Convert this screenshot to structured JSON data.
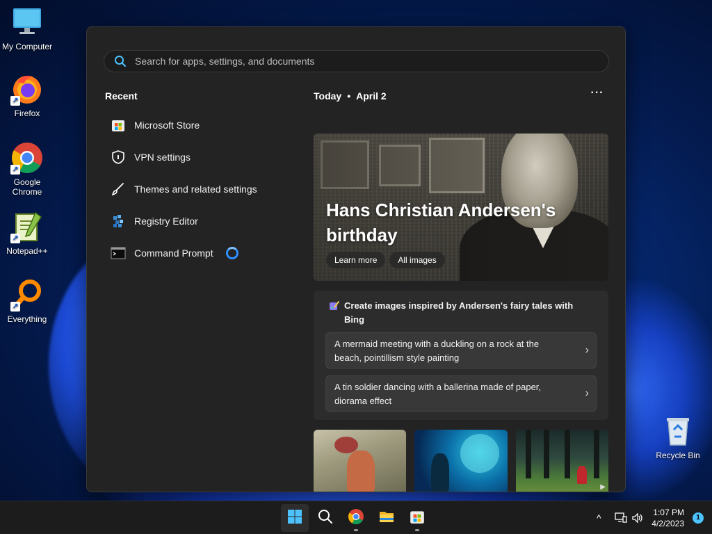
{
  "desktop": {
    "icons": [
      {
        "label": "My Computer",
        "icon": "monitor-icon"
      },
      {
        "label": "Firefox",
        "icon": "firefox-icon"
      },
      {
        "label": "Google Chrome",
        "icon": "chrome-icon"
      },
      {
        "label": "Notepad++",
        "icon": "notepadpp-icon"
      },
      {
        "label": "Everything",
        "icon": "everything-icon"
      },
      {
        "label": "Recycle Bin",
        "icon": "recycle-bin-icon"
      }
    ]
  },
  "start": {
    "search_placeholder": "Search for apps, settings, and documents",
    "recent_title": "Recent",
    "recent": [
      {
        "label": "Microsoft Store",
        "icon": "store-icon"
      },
      {
        "label": "VPN settings",
        "icon": "shield-icon"
      },
      {
        "label": "Themes and related settings",
        "icon": "brush-icon"
      },
      {
        "label": "Registry Editor",
        "icon": "registry-icon"
      },
      {
        "label": "Command Prompt",
        "icon": "cmd-icon"
      }
    ],
    "today_label": "Today",
    "today_sep": "•",
    "today_date": "April 2",
    "more_label": "···",
    "hero": {
      "title": "Hans Christian Andersen's birthday",
      "btn_learn": "Learn more",
      "btn_images": "All images"
    },
    "bing": {
      "heading": "Create images inspired by Andersen's fairy tales with Bing",
      "prompts": [
        "A mermaid meeting with a duckling on a rock at the beach, pointillism style painting",
        "A tin soldier dancing with a ballerina made of paper, diorama effect"
      ],
      "chevron": "›"
    }
  },
  "taskbar": {
    "apps": [
      "start-icon",
      "search-icon",
      "chrome-icon",
      "file-explorer-icon",
      "store-icon"
    ],
    "tray_chevron": "^",
    "time": "1:07 PM",
    "date": "4/2/2023",
    "notification_count": "1"
  },
  "colors": {
    "accent": "#4cc2ff",
    "panel_bg": "#232323",
    "card_bg": "#2c2c2c"
  }
}
